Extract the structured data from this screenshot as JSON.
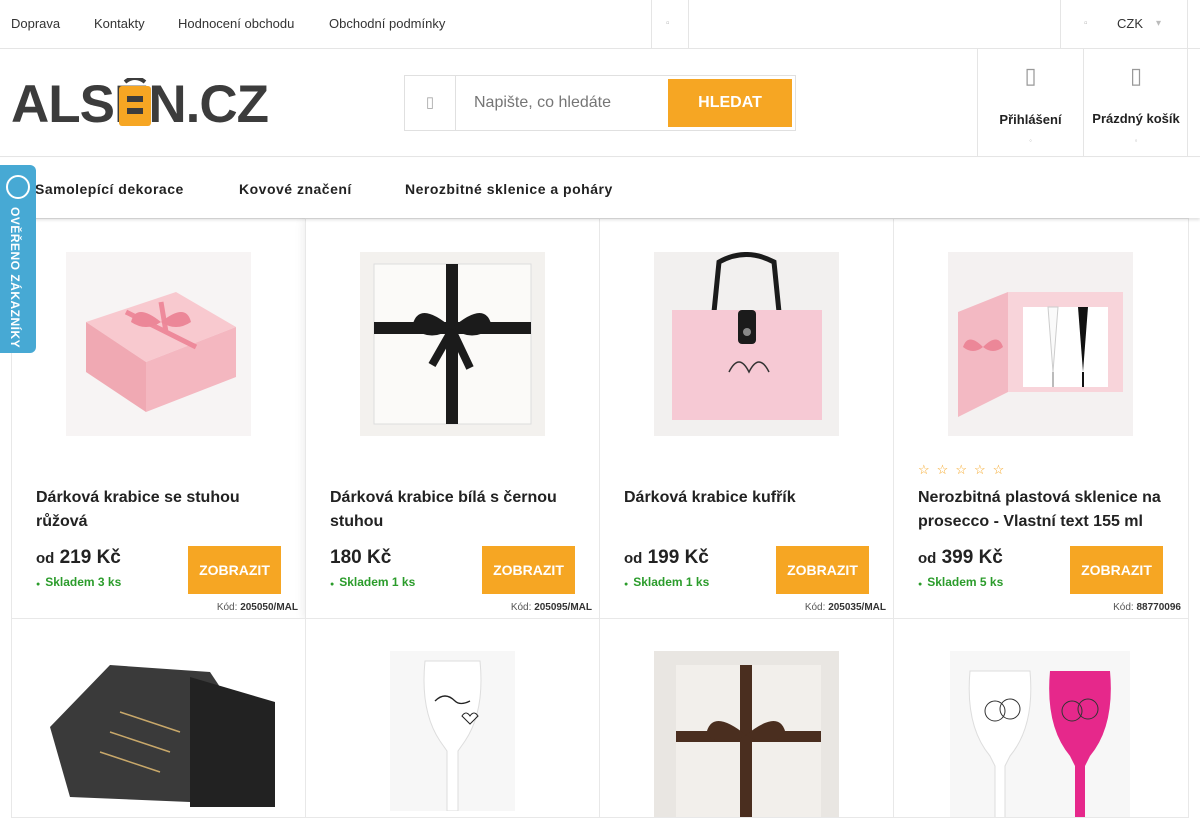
{
  "topbar": {
    "links": [
      "Doprava",
      "Kontakty",
      "Hodnocení obchodu",
      "Obchodní podmínky"
    ],
    "currency": "CZK"
  },
  "logo": {
    "text": "ALSEN.CZ"
  },
  "search": {
    "placeholder": "Napište, co hledáte",
    "button": "HLEDAT"
  },
  "header": {
    "login": "Přihlášení",
    "cart": "Prázdný košík"
  },
  "nav": {
    "items": [
      "Samolepící dekorace",
      "Kovové značení",
      "Nerozbitné sklenice a poháry"
    ]
  },
  "badge": {
    "text": "OVĚŘENO ZÁKAZNÍKY"
  },
  "products": [
    {
      "title": "Dárková krabice se stuhou růžová",
      "price_prefix": "od",
      "price": "219 Kč",
      "stock": "Skladem 3 ks",
      "button": "ZOBRAZIT",
      "code_label": "Kód:",
      "code": "205050/MAL"
    },
    {
      "title": "Dárková krabice bílá s černou stuhou",
      "price_prefix": "",
      "price": "180 Kč",
      "stock": "Skladem 1 ks",
      "button": "ZOBRAZIT",
      "code_label": "Kód:",
      "code": "205095/MAL"
    },
    {
      "title": "Dárková krabice kufřík",
      "price_prefix": "od",
      "price": "199 Kč",
      "stock": "Skladem 1 ks",
      "button": "ZOBRAZIT",
      "code_label": "Kód:",
      "code": "205035/MAL"
    },
    {
      "title": "Nerozbitná plastová sklenice na prosecco - Vlastní text 155 ml",
      "price_prefix": "od",
      "price": "399 Kč",
      "stock": "Skladem 5 ks",
      "button": "ZOBRAZIT",
      "code_label": "Kód:",
      "code": "88770096",
      "rating_stars": 5
    }
  ],
  "colors": {
    "accent": "#f6a623",
    "stock": "#2b9c2b",
    "badge": "#47a9d4"
  }
}
